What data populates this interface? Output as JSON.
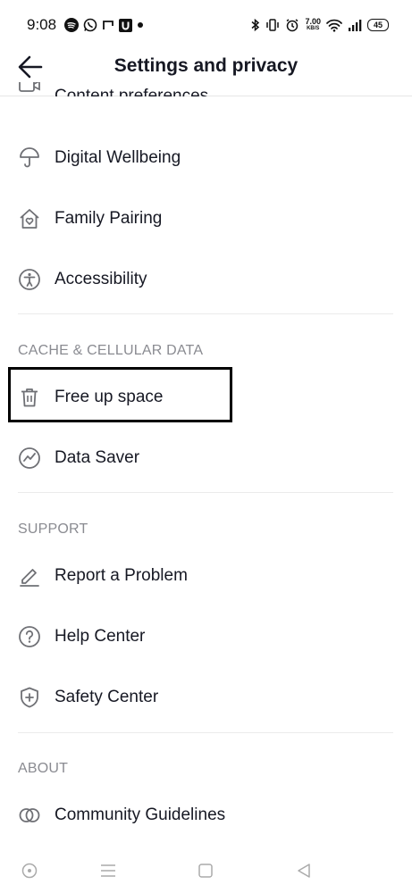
{
  "status_bar": {
    "time": "9:08",
    "speed_value": "7.00",
    "speed_unit": "KB/S",
    "battery": "45"
  },
  "header": {
    "title": "Settings and privacy"
  },
  "partial_item": {
    "label": "Content preferences"
  },
  "items": [
    {
      "label": "Digital Wellbeing",
      "icon": "umbrella-icon"
    },
    {
      "label": "Family Pairing",
      "icon": "home-heart-icon"
    },
    {
      "label": "Accessibility",
      "icon": "accessibility-icon"
    }
  ],
  "sections": {
    "cache": {
      "title": "CACHE & CELLULAR DATA",
      "items": [
        {
          "label": "Free up space",
          "icon": "trash-icon"
        },
        {
          "label": "Data Saver",
          "icon": "data-saver-icon"
        }
      ]
    },
    "support": {
      "title": "SUPPORT",
      "items": [
        {
          "label": "Report a Problem",
          "icon": "pencil-icon"
        },
        {
          "label": "Help Center",
          "icon": "question-circle-icon"
        },
        {
          "label": "Safety Center",
          "icon": "shield-icon"
        }
      ]
    },
    "about": {
      "title": "ABOUT",
      "items": [
        {
          "label": "Community Guidelines",
          "icon": "rings-icon"
        }
      ]
    }
  },
  "colors": {
    "text": "#161823",
    "section": "#8a8b91",
    "icon": "#6f7075",
    "divider": "#ebebeb",
    "highlight": "#000000"
  }
}
